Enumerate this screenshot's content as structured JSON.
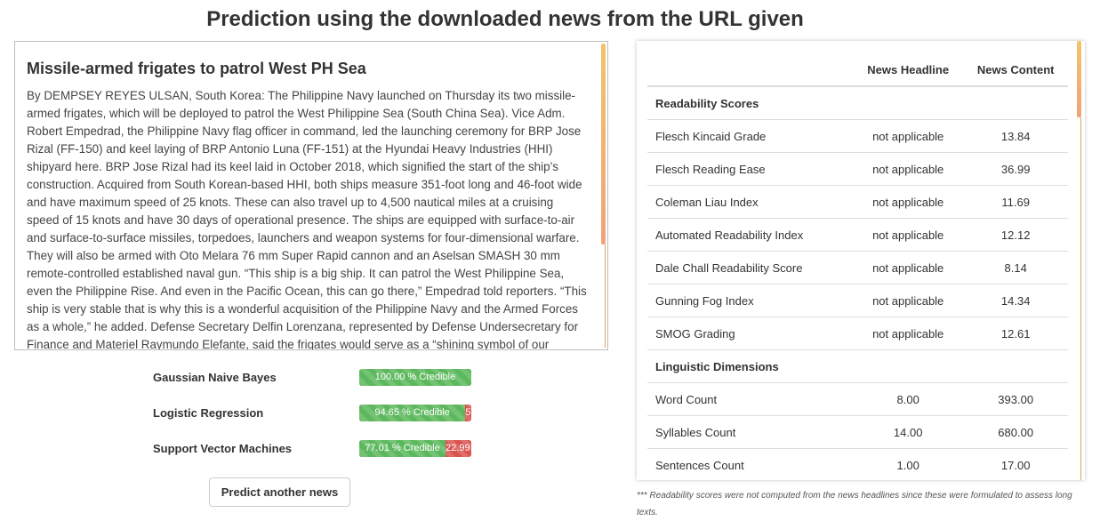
{
  "page": {
    "title": "Prediction using the downloaded news from the URL given"
  },
  "article": {
    "title": "Missile-armed frigates to patrol West PH Sea",
    "body": "By DEMPSEY REYES ULSAN, South Korea: The Philippine Navy launched on Thursday its two missile-armed frigates, which will be deployed to patrol the West Philippine Sea (South China Sea). Vice Adm. Robert Empedrad, the Philippine Navy flag officer in command, led the launching ceremony for BRP Jose Rizal (FF-150) and keel laying of BRP Antonio Luna (FF-151) at the Hyundai Heavy Industries (HHI) shipyard here. BRP Jose Rizal had its keel laid in October 2018, which signified the start of the ship’s construction. Acquired from South Korean-based HHI, both ships measure 351-foot long and 46-foot wide and have maximum speed of 25 knots. These can also travel up to 4,500 nautical miles at a cruising speed of 15 knots and have 30 days of operational presence. The ships are equipped with surface-to-air and surface-to-surface missiles, torpedoes, launchers and weapon systems for four-dimensional warfare. They will also be armed with Oto Melara 76 mm Super Rapid cannon and an Aselsan SMASH 30 mm remote-controlled established naval gun. “This ship is a big ship. It can patrol the West Philippine Sea, even the Philippine Rise. And even in the Pacific Ocean, this can go there,” Empedrad told reporters. “This ship is very stable that is why this is a wonderful acquisition of the Philippine Navy and the Armed Forces as a whole,” he added. Defense Secretary Delfin Lorenzana, represented by Defense Undersecretary for Finance and Materiel Raymundo Elefante, said the frigates would serve as a “shining symbol of our"
  },
  "models": [
    {
      "name": "Gaussian Naive Bayes",
      "credible_pct": 100.0,
      "credible_label": "100.00 % Credible",
      "not_label": ""
    },
    {
      "name": "Logistic Regression",
      "credible_pct": 94.65,
      "credible_label": "94.65 % Credible",
      "not_label": "5"
    },
    {
      "name": "Support Vector Machines",
      "credible_pct": 77.01,
      "credible_label": "77.01 % Credible",
      "not_label": "22.99"
    }
  ],
  "predict_button": "Predict another news",
  "scores": {
    "headers": [
      "",
      "News Headline",
      "News Content"
    ],
    "rows": [
      {
        "section": true,
        "label": "Readability Scores",
        "headline": "",
        "content": ""
      },
      {
        "label": "Flesch Kincaid Grade",
        "headline": "not applicable",
        "content": "13.84"
      },
      {
        "label": "Flesch Reading Ease",
        "headline": "not applicable",
        "content": "36.99"
      },
      {
        "label": "Coleman Liau Index",
        "headline": "not applicable",
        "content": "11.69"
      },
      {
        "label": "Automated Readability Index",
        "headline": "not applicable",
        "content": "12.12"
      },
      {
        "label": "Dale Chall Readability Score",
        "headline": "not applicable",
        "content": "8.14"
      },
      {
        "label": "Gunning Fog Index",
        "headline": "not applicable",
        "content": "14.34"
      },
      {
        "label": "SMOG Grading",
        "headline": "not applicable",
        "content": "12.61"
      },
      {
        "section": true,
        "label": "Linguistic Dimensions",
        "headline": "",
        "content": ""
      },
      {
        "label": "Word Count",
        "headline": "8.00",
        "content": "393.00"
      },
      {
        "label": "Syllables Count",
        "headline": "14.00",
        "content": "680.00"
      },
      {
        "label": "Sentences Count",
        "headline": "1.00",
        "content": "17.00"
      }
    ]
  },
  "footnote": "*** Readability scores were not computed from the news headlines since these were formulated to assess long texts.",
  "colors": {
    "credible": "#5cb85c",
    "not_credible": "#d9534f",
    "scroll_thumb": "#f3c46a"
  }
}
